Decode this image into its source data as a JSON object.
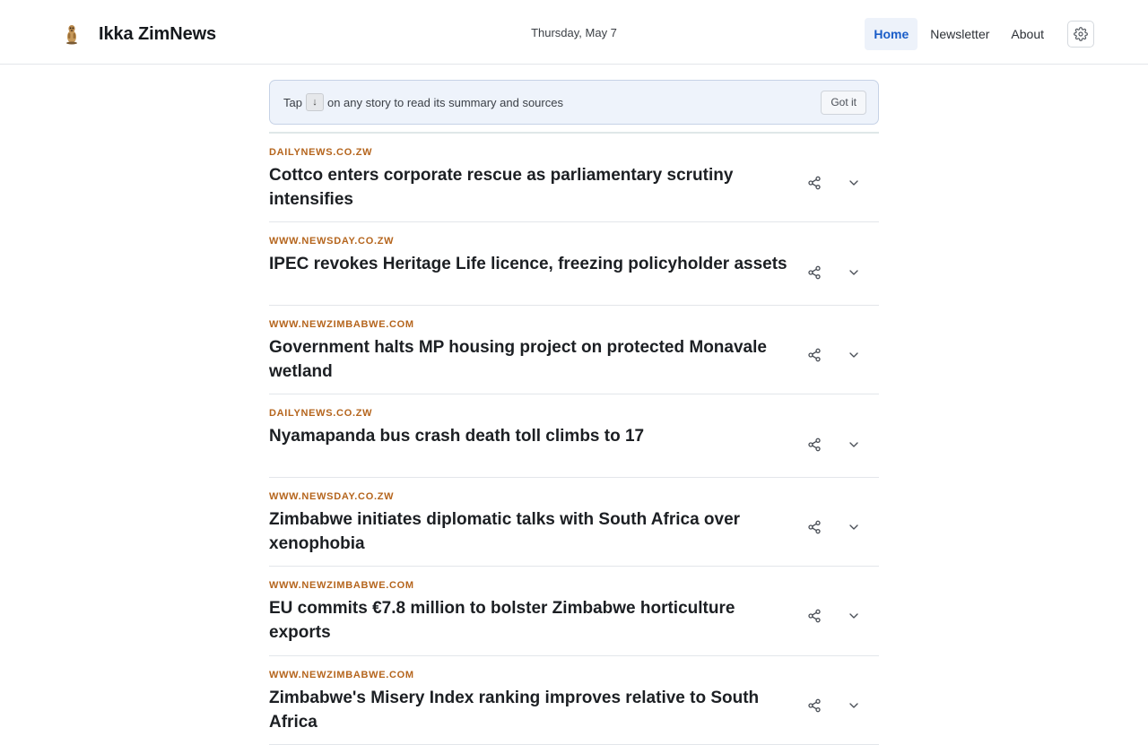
{
  "header": {
    "brand_name": "Ikka ZimNews",
    "logo_icon": "meerkat-logo-icon",
    "date": "Thursday, May 7",
    "nav": [
      {
        "label": "Home",
        "active": true
      },
      {
        "label": "Newsletter",
        "active": false
      },
      {
        "label": "About",
        "active": false
      }
    ],
    "settings_icon": "gear-icon"
  },
  "tip": {
    "text_before": "Tap",
    "key": "↓",
    "text_after": "on any story to read its summary and sources",
    "dismiss_label": "Got it"
  },
  "colors": {
    "accent": "#1a5dc8",
    "source": "#b5651d",
    "tip_background": "#eef3fb"
  },
  "stories": [
    {
      "source": "DAILYNEWS.CO.ZW",
      "title": "Cottco enters corporate rescue as parliamentary scrutiny intensifies"
    },
    {
      "source": "WWW.NEWSDAY.CO.ZW",
      "title": "IPEC revokes Heritage Life licence, freezing policyholder assets"
    },
    {
      "source": "WWW.NEWZIMBABWE.COM",
      "title": "Government halts MP housing project on protected Monavale wetland"
    },
    {
      "source": "DAILYNEWS.CO.ZW",
      "title": "Nyamapanda bus crash death toll climbs to 17"
    },
    {
      "source": "WWW.NEWSDAY.CO.ZW",
      "title": "Zimbabwe initiates diplomatic talks with South Africa over xenophobia"
    },
    {
      "source": "WWW.NEWZIMBABWE.COM",
      "title": "EU commits €7.8 million to bolster Zimbabwe horticulture exports"
    },
    {
      "source": "WWW.NEWZIMBABWE.COM",
      "title": "Zimbabwe's Misery Index ranking improves relative to South Africa"
    }
  ]
}
